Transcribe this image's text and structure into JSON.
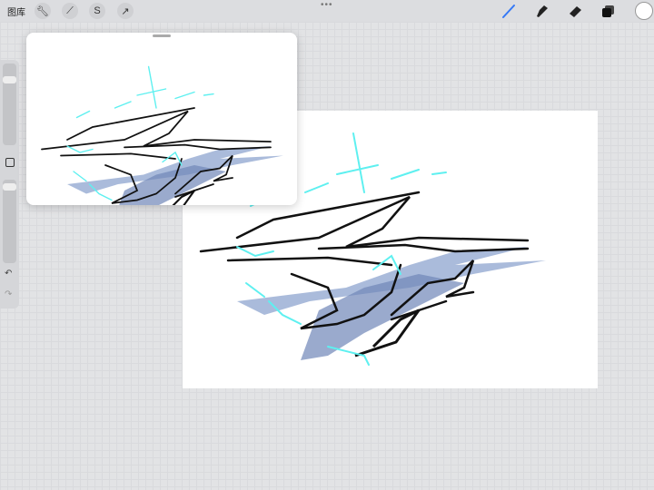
{
  "topbar": {
    "gallery_label": "图库",
    "tools": [
      "wrench-icon",
      "magic-wand-icon",
      "selection-icon",
      "transform-arrow-icon"
    ],
    "right_tools": [
      "brush-icon",
      "smudge-icon",
      "eraser-icon",
      "layers-icon",
      "color-swatch"
    ],
    "active_color": "#ffffff",
    "accent": "#3478f6"
  },
  "sidebar": {
    "icons": [
      "modify-square-icon",
      "undo-icon",
      "redo-icon"
    ]
  },
  "reference": {
    "title": "reference-window"
  },
  "colors": {
    "stroke": "#111111",
    "cyan": "#5ef0f0",
    "blue": "#7d96c4"
  }
}
